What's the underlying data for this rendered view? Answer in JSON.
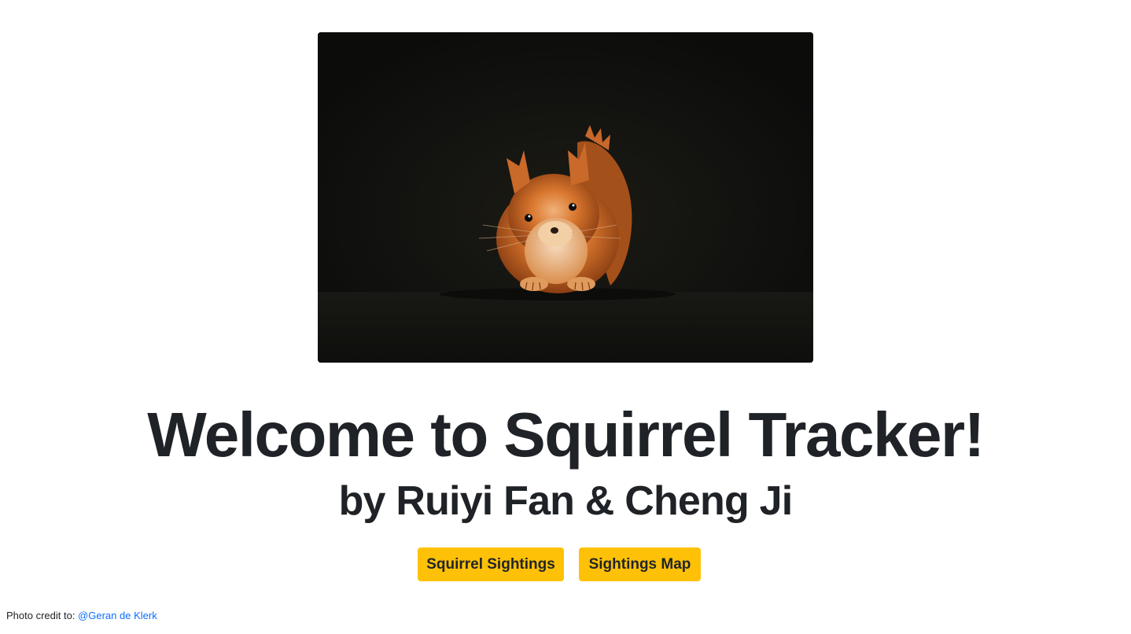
{
  "hero": {
    "image_subject": "red squirrel on dark background"
  },
  "title": "Welcome to Squirrel Tracker!",
  "subtitle": "by Ruiyi Fan & Cheng Ji",
  "buttons": {
    "sightings_label": "Squirrel Sightings",
    "map_label": "Sightings Map"
  },
  "credit": {
    "prefix": "Photo credit to: ",
    "author": "@Geran de Klerk"
  },
  "colors": {
    "button_bg": "#ffc107",
    "link": "#0d6efd",
    "heading": "#1f2226"
  }
}
